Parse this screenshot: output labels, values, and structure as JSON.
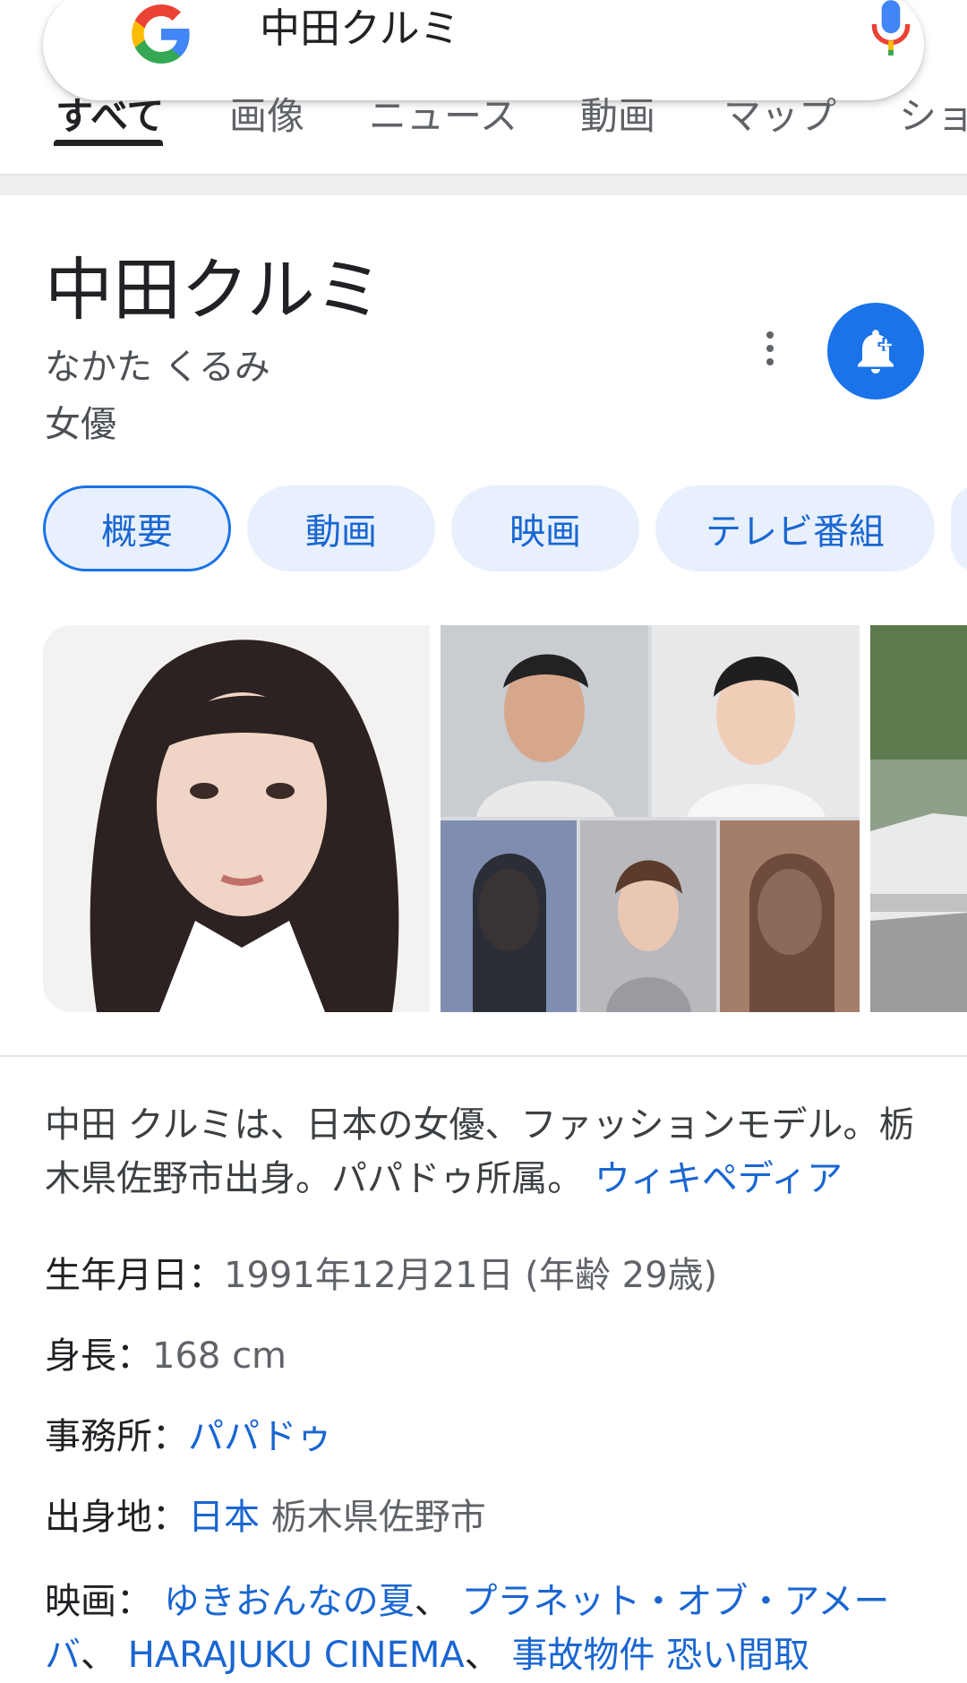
{
  "search": {
    "query": "中田クルミ"
  },
  "tabs": [
    "すべて",
    "画像",
    "ニュース",
    "動画",
    "マップ",
    "ショ"
  ],
  "panel": {
    "title": "中田クルミ",
    "reading": "なかた くるみ",
    "type": "女優",
    "chips": [
      "概要",
      "動画",
      "映画",
      "テレビ番組"
    ]
  },
  "description": {
    "text": "中田 クルミは、日本の女優、ファッションモデル。栃木県佐野市出身。パパドゥ所属。",
    "source": "ウィキペディア"
  },
  "facts": {
    "birth_label": "生年月日：",
    "birth_value": "1991年12月21日 (年齢 29歳)",
    "height_label": "身長：",
    "height_value": "168 cm",
    "agency_label": "事務所：",
    "agency_value": "パパドゥ",
    "origin_label": "出身地：",
    "origin_link": "日本",
    "origin_value": "栃木県佐野市",
    "films_label": "映画：",
    "films": [
      "ゆきおんなの夏",
      "プラネット・オブ・アメーバ",
      "HARAJUKU CINEMA",
      "事故物件 恐い間取"
    ],
    "films_sep": "、"
  },
  "colors": {
    "accent": "#1a73e8",
    "link": "#1a66d1",
    "chip_bg": "#e8f0fe"
  }
}
